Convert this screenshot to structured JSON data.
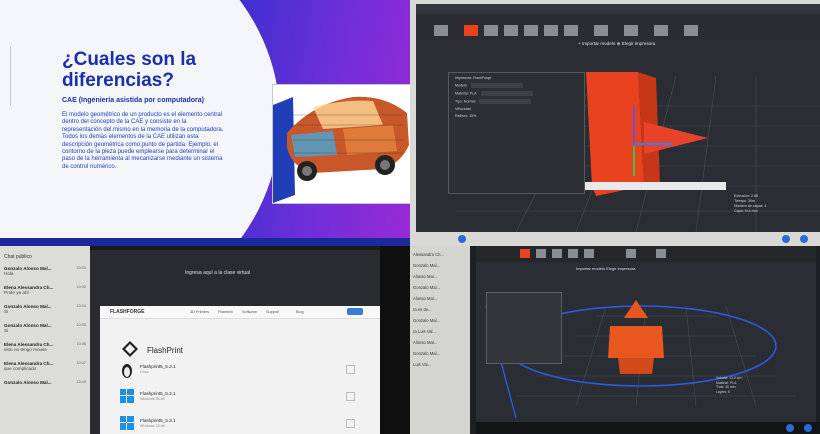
{
  "slide": {
    "title": "¿Cuales son la diferencias?",
    "subtitle": "CAE (Ingeniería asistida por computadora)",
    "body": "El modelo geométrico de un producto es el elemento central dentro del concepto de la CAE y consiste en la representación del mismo en la memoria de la computadora. Todos los demás elementos de la CAE utilizan esta descripción geométrica como punto de partida. Ejemplo, el contorno de la pieza puede emplearse para determinar el paso de la herramienta al mecanizarse mediante un sistema de control numérico."
  },
  "slicer_top": {
    "subbar": "+ Importar modelo   ⊕ Elegir impresora",
    "dialog_rows": [
      "Impresora: FlashForge",
      "Modelo",
      "Material: PLA",
      "Tipo: Normal",
      "Velocidad",
      "Relleno: 15%"
    ],
    "info_lines": [
      "Extrusión: 2.98",
      "Tiempo: 39m",
      "Número de capas: 4",
      "Capa: 9×4 mm"
    ],
    "accent_color": "#e8431e"
  },
  "classroom": {
    "panel_header": "Chat público",
    "messages": [
      {
        "name": "Gonzalo Alonso Mal...",
        "text": "Hola",
        "time": "10:00"
      },
      {
        "name": "Elena Alessandra Ch...",
        "text": "Profe ya ahí",
        "time": "10:02"
      },
      {
        "name": "Gonzalo Alonso Mal...",
        "text": "Si",
        "time": "10:04"
      },
      {
        "name": "Gonzalo Alonso Mal...",
        "text": "Si",
        "time": "10:05"
      },
      {
        "name": "Elena Alessandra Ch...",
        "text": "esto no tengo mouse",
        "time": "10:06"
      },
      {
        "name": "Elena Alessandra Ch...",
        "text": "que complicado",
        "time": "10:07"
      },
      {
        "name": "Gonzalo Alonso Mal...",
        "text": "",
        "time": "10:09"
      }
    ],
    "header_line": "Ingresa aquí a la clase virtual",
    "brand": "FLASHFORGE",
    "nav": [
      "3D Printers",
      "Filament",
      "Software",
      "Support",
      "Blog"
    ],
    "product_title": "FlashPrint",
    "downloads": [
      {
        "name": "Flashprint5_5.3.1",
        "desc": "Linux"
      },
      {
        "name": "Flashprint5_5.3.1",
        "desc": "Windows 64-bit"
      },
      {
        "name": "Flashprint5_5.3.1",
        "desc": "Windows 32-bit"
      }
    ]
  },
  "slicer_bottom": {
    "participants": [
      "Alessandra Ch...",
      "Gonzalo Mal...",
      "Alonso Mal...",
      "Gonzalo Mal...",
      "Alonso Mal...",
      "ra es de...",
      "Gonzalo Mal...",
      "ra Luis Val...",
      "Alonso Mal...",
      "Gonzalo Mal...",
      "Luis Val..."
    ],
    "subbar": "Importar modelo   Elegir impresora",
    "info_lines": [
      "Volume: 12.0 cm³",
      "Material: PLA",
      "Time: 40 min",
      "Layers: 5"
    ]
  }
}
